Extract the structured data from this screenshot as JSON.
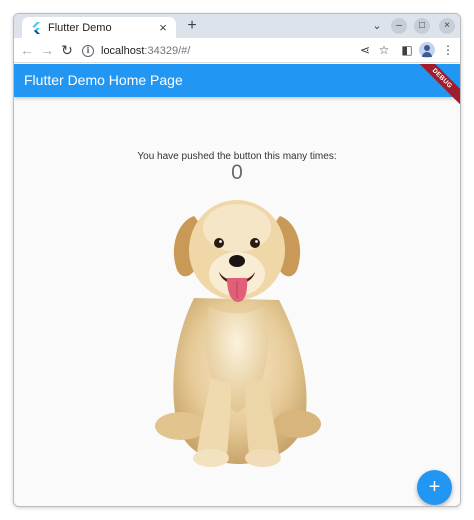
{
  "browser": {
    "tab_title": "Flutter Demo",
    "tab_close_icon": "×",
    "new_tab_icon": "+",
    "tab_search_icon": "⌄",
    "window_controls": {
      "minimize": "–",
      "maximize": "□",
      "close": "×"
    },
    "nav": {
      "back": "←",
      "forward": "→",
      "reload": "↻"
    },
    "url_host": "localhost",
    "url_rest": ":34329/#/",
    "toolbar_icons": {
      "share": "⋖",
      "bookmark": "☆",
      "side_panel": "◧",
      "menu": "⋮"
    }
  },
  "app": {
    "title": "Flutter Demo Home Page",
    "debug_banner": "DEBUG",
    "counter_label": "You have pushed the button this many times:",
    "counter_value": "0",
    "fab_label": "+",
    "accent_color": "#2196f3",
    "banner_color": "#a01e2a"
  }
}
